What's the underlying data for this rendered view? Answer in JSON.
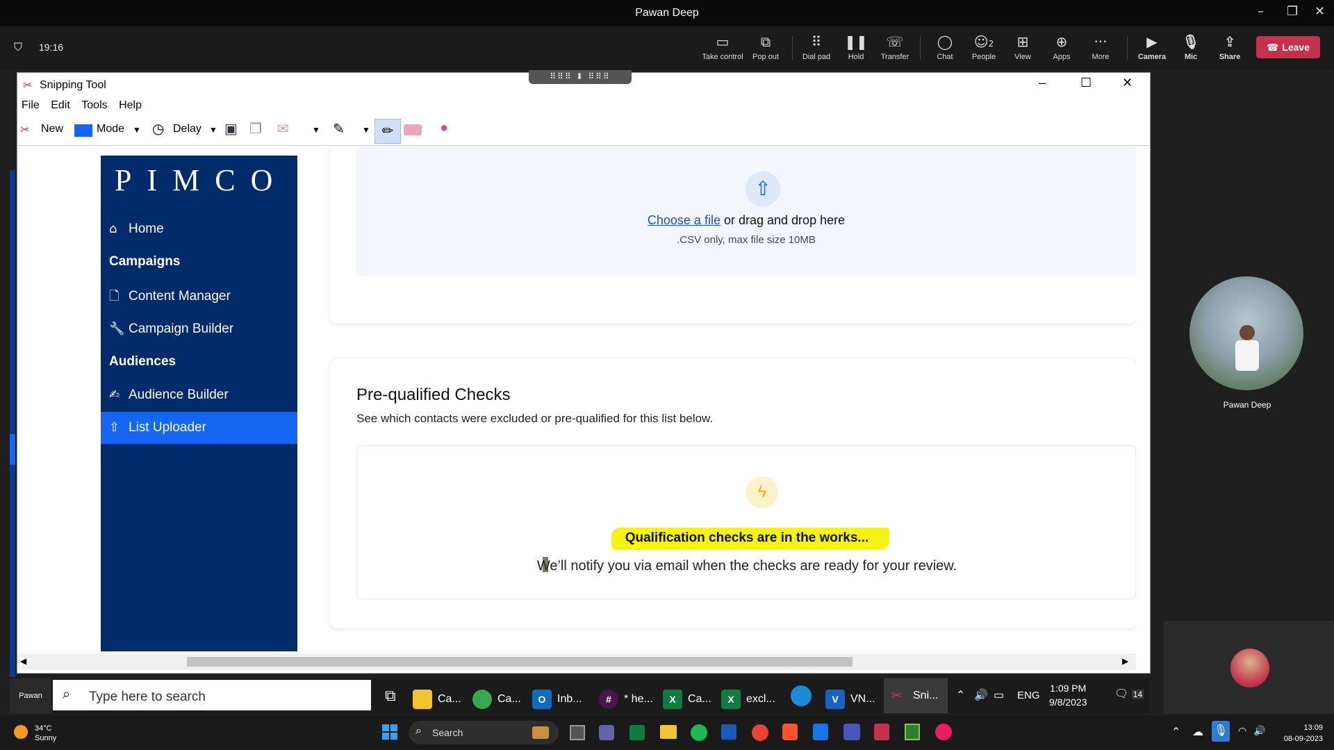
{
  "teams": {
    "window_title": "Pawan Deep",
    "time": "19:16",
    "controls": {
      "take_control": "Take control",
      "pop_out": "Pop out",
      "dial_pad": "Dial pad",
      "hold": "Hold",
      "transfer": "Transfer",
      "chat": "Chat",
      "people": "People",
      "people_count": "2",
      "view": "View",
      "apps": "Apps",
      "more": "More",
      "camera": "Camera",
      "mic": "Mic",
      "share": "Share",
      "leave": "Leave"
    },
    "participant_name": "Pawan Deep",
    "self_label": "Pawan Deep"
  },
  "snipping_tool": {
    "title": "Snipping Tool",
    "menu": [
      "File",
      "Edit",
      "Tools",
      "Help"
    ],
    "toolbar": {
      "new": "New",
      "mode": "Mode",
      "delay": "Delay"
    }
  },
  "app": {
    "logo": "PIMCO",
    "nav": {
      "home": "Home",
      "campaigns": "Campaigns",
      "content_manager": "Content Manager",
      "campaign_builder": "Campaign Builder",
      "audiences": "Audiences",
      "audience_builder": "Audience Builder",
      "list_uploader": "List Uploader"
    },
    "upload": {
      "link": "Choose a file",
      "text": "or drag and drop here",
      "hint": ".CSV only, max file size 10MB"
    },
    "checks": {
      "title": "Pre-qualified Checks",
      "subtitle": "See which contacts were excluded or pre-qualified for this list below.",
      "status_title": "Qualification checks are in the works...",
      "status_text": "We’ll notify you via email when the checks are ready for your review."
    }
  },
  "taskbar_inner": {
    "search_placeholder": "Type here to search",
    "items": [
      "Ca...",
      "Ca...",
      "Inb...",
      "* he...",
      "Ca...",
      "excl...",
      "VN...",
      "Sni..."
    ],
    "lang": "ENG",
    "time": "1:09 PM",
    "date": "9/8/2023",
    "notifications": "14"
  },
  "taskbar_outer": {
    "temp": "34°C",
    "weather": "Sunny",
    "search": "Search",
    "time": "13:09",
    "date": "08-09-2023"
  }
}
